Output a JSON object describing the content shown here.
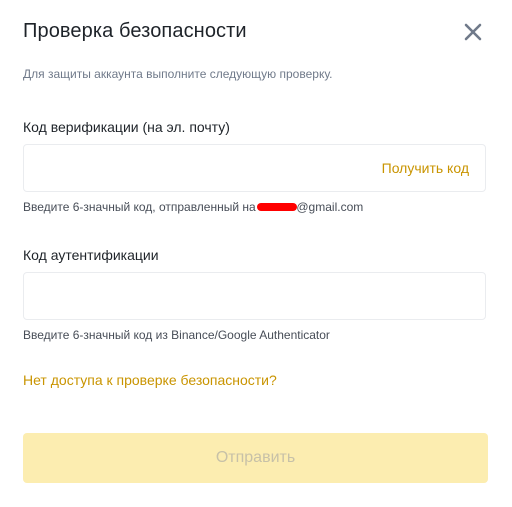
{
  "dialog": {
    "title": "Проверка безопасности",
    "subtitle": "Для защиты аккаунта выполните следующую проверку.",
    "close_icon": "close-icon"
  },
  "email_verification": {
    "label": "Код верификации (на эл. почту)",
    "value": "",
    "placeholder": "",
    "get_code_label": "Получить код",
    "hint_prefix": "Введите 6-значный код, отправленный на",
    "hint_suffix": "@gmail.com"
  },
  "authenticator": {
    "label": "Код аутентификации",
    "value": "",
    "placeholder": "",
    "hint": "Введите 6-значный код из Binance/Google Authenticator"
  },
  "links": {
    "no_access": "Нет доступа к проверке безопасности?"
  },
  "submit": {
    "label": "Отправить",
    "disabled": true
  },
  "colors": {
    "accent": "#c99400",
    "submit_disabled_bg": "#fcedb0",
    "submit_disabled_text": "#c7c1a8",
    "redaction": "#ff0000"
  }
}
